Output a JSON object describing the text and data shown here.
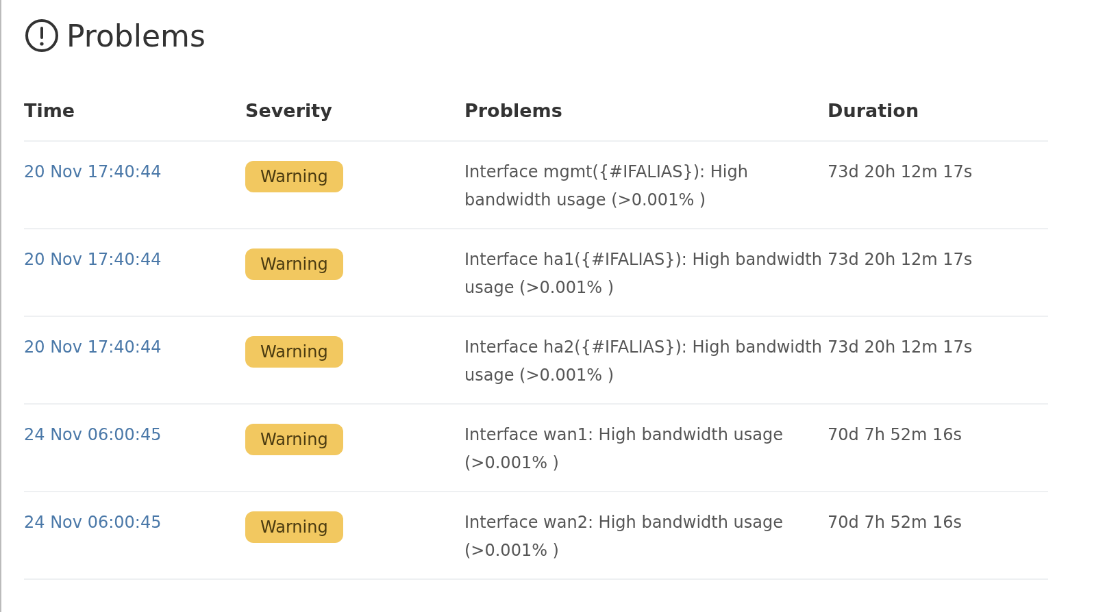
{
  "title": "Problems",
  "table": {
    "columns": [
      "Time",
      "Severity",
      "Problems",
      "Duration"
    ],
    "rows": [
      {
        "time": "20 Nov 17:40:44",
        "severity": {
          "label": "Warning",
          "kind": "warning"
        },
        "problem": "Interface mgmt({#IFALIAS}): High bandwidth usage (>0.001% )",
        "duration": "73d 20h 12m 17s"
      },
      {
        "time": "20 Nov 17:40:44",
        "severity": {
          "label": "Warning",
          "kind": "warning"
        },
        "problem": "Interface ha1({#IFALIAS}): High bandwidth usage (>0.001% )",
        "duration": "73d 20h 12m 17s"
      },
      {
        "time": "20 Nov 17:40:44",
        "severity": {
          "label": "Warning",
          "kind": "warning"
        },
        "problem": "Interface ha2({#IFALIAS}): High bandwidth usage (>0.001% )",
        "duration": "73d 20h 12m 17s"
      },
      {
        "time": "24 Nov 06:00:45",
        "severity": {
          "label": "Warning",
          "kind": "warning"
        },
        "problem": "Interface wan1: High bandwidth usage (>0.001% )",
        "duration": "70d 7h 52m 16s"
      },
      {
        "time": "24 Nov 06:00:45",
        "severity": {
          "label": "Warning",
          "kind": "warning"
        },
        "problem": "Interface wan2: High bandwidth usage (>0.001% )",
        "duration": "70d 7h 52m 16s"
      }
    ]
  }
}
